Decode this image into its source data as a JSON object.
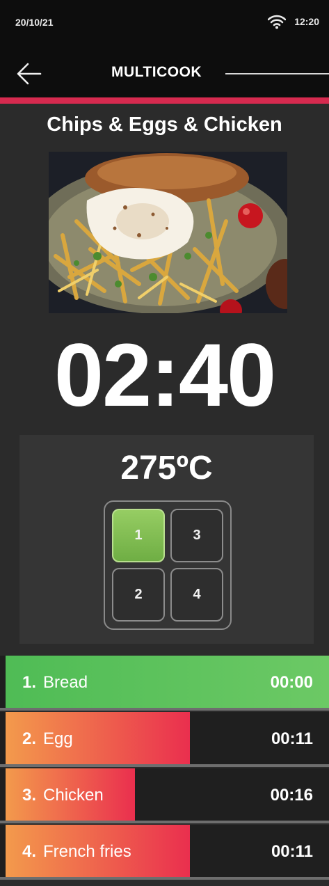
{
  "status": {
    "date": "20/10/21",
    "time": "12:20"
  },
  "header": {
    "title": "MULTICOOK"
  },
  "recipe": {
    "title": "Chips & Eggs & Chicken"
  },
  "timer": {
    "value": "02:40"
  },
  "temperature": {
    "value": "275ºC"
  },
  "zones": [
    {
      "label": "1",
      "selected": true
    },
    {
      "label": "3",
      "selected": false
    },
    {
      "label": "2",
      "selected": false
    },
    {
      "label": "4",
      "selected": false
    }
  ],
  "steps": [
    {
      "number": "1.",
      "name": "Bread",
      "time": "00:00",
      "state": "done",
      "progress": 1.0
    },
    {
      "number": "2.",
      "name": "Egg",
      "time": "00:11",
      "state": "running",
      "progress": 0.57
    },
    {
      "number": "3.",
      "name": "Chicken",
      "time": "00:16",
      "state": "running",
      "progress": 0.4
    },
    {
      "number": "4.",
      "name": "French fries",
      "time": "00:11",
      "state": "running",
      "progress": 0.57
    }
  ],
  "colors": {
    "accent": "#d62a4f",
    "done": "#5dc05a",
    "running_start": "#f39a4c",
    "running_end": "#ea2f4e",
    "zone_active": "#7fbb50"
  }
}
